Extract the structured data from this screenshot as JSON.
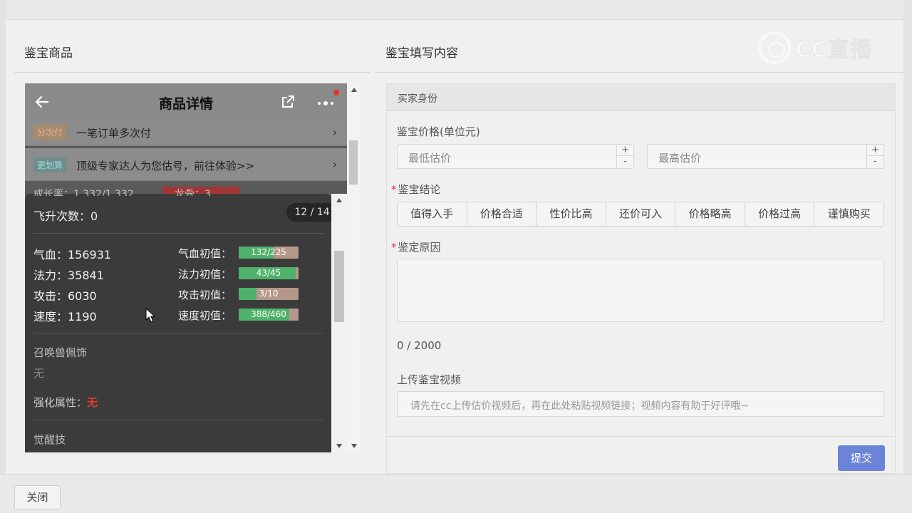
{
  "sections": {
    "left_title": "鉴宝商品",
    "right_title": "鉴宝填写内容"
  },
  "watermark": {
    "text": "CC直播"
  },
  "phone": {
    "title": "商品详情",
    "icons": {
      "back": "arrow-left-icon",
      "share": "share-icon",
      "more": "more-dots-icon"
    },
    "rows": [
      {
        "tag": "分次付",
        "text": "一笔订单多次付"
      },
      {
        "tag": "更划算",
        "text": "顶级专家达人为您估号，前往体验>>"
      }
    ],
    "partial_text": "成长率：1.332/1.332",
    "partial_text_right": "龙骨：3",
    "fly_label": "飞升次数：0",
    "page_indicator": "12 / 14",
    "stats": [
      {
        "label": "气血：156931",
        "init_label": "气血初值：",
        "bar_text": "132/225",
        "fill": 0.587
      },
      {
        "label": "法力：35841",
        "init_label": "法力初值：",
        "bar_text": "43/45",
        "fill": 0.956
      },
      {
        "label": "攻击：6030",
        "init_label": "攻击初值：",
        "bar_text": "3/10",
        "fill": 0.3
      },
      {
        "label": "速度：1190",
        "init_label": "速度初值：",
        "bar_text": "388/460",
        "fill": 0.843
      }
    ],
    "accessory_title": "召唤兽佩饰",
    "accessory_value": "无",
    "enhance_label": "强化属性：",
    "enhance_value": "无",
    "awaken_title": "觉醒技"
  },
  "form": {
    "buyer_header": "买家身份",
    "price_label": "鉴宝价格(单位元)",
    "min_placeholder": "最低估价",
    "max_placeholder": "最高估价",
    "conclusion_label": "鉴宝结论",
    "conclusion_options": [
      "值得入手",
      "价格合适",
      "性价比高",
      "还价可入",
      "价格略高",
      "价格过高",
      "谨慎购买"
    ],
    "reason_label": "鉴定原因",
    "reason_counter": "0 / 2000",
    "video_label": "上传鉴宝视频",
    "video_placeholder": "请先在cc上传估价视频后，再在此处粘贴视频链接；视频内容有助于好评哦~",
    "submit_label": "提交",
    "stepper_plus": "+",
    "stepper_minus": "-"
  },
  "footer": {
    "close_label": "关闭"
  }
}
